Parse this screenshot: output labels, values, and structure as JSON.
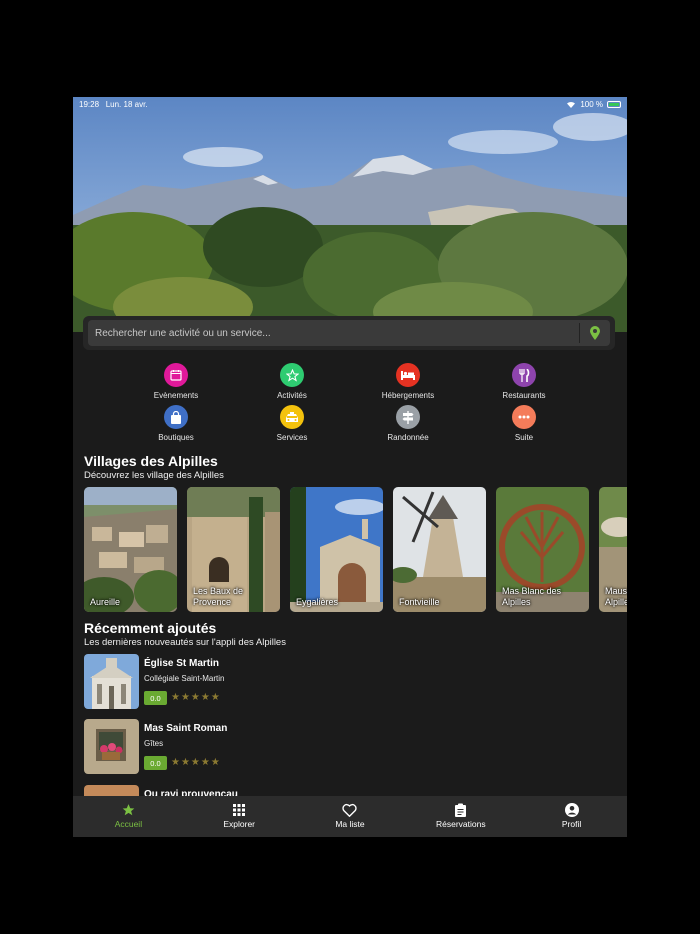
{
  "status_bar": {
    "time": "19:28",
    "date": "Lun. 18 avr.",
    "battery": "100 %"
  },
  "search": {
    "placeholder": "Rechercher une activité ou un service..."
  },
  "categories": [
    {
      "label": "Evènements",
      "icon": "calendar-icon",
      "color": "#e0199a"
    },
    {
      "label": "Activités",
      "icon": "star-icon",
      "color": "#2ecc71"
    },
    {
      "label": "Hébergements",
      "icon": "bed-icon",
      "color": "#e53222"
    },
    {
      "label": "Restaurants",
      "icon": "utensils-icon",
      "color": "#8e44ad"
    },
    {
      "label": "Boutiques",
      "icon": "bag-icon",
      "color": "#3f6fc6"
    },
    {
      "label": "Services",
      "icon": "taxi-icon",
      "color": "#f4c20d"
    },
    {
      "label": "Randonnée",
      "icon": "signpost-icon",
      "color": "#9aa0a6"
    },
    {
      "label": "Suite",
      "icon": "more-icon",
      "color": "#f47c5a"
    }
  ],
  "villages": {
    "title": "Villages des Alpilles",
    "subtitle": "Découvrez les village des Alpilles",
    "items": [
      {
        "label": "Aureille"
      },
      {
        "label": "Les Baux de Provence"
      },
      {
        "label": "Eygalières"
      },
      {
        "label": "Fontvieille"
      },
      {
        "label": "Mas Blanc des Alpilles"
      },
      {
        "label": "Maussane les Alpilles"
      }
    ]
  },
  "recent": {
    "title": "Récemment ajoutés",
    "subtitle": "Les dernières nouveautés sur l'appli des Alpilles",
    "items": [
      {
        "title": "Église St Martin",
        "subtitle": "Collégiale Saint-Martin",
        "score": "0.0",
        "stars": "★★★★★"
      },
      {
        "title": "Mas Saint Roman",
        "subtitle": "Gîtes",
        "score": "0.0",
        "stars": "★★★★★"
      },
      {
        "title": "Ou ravi prouvençau",
        "subtitle": "",
        "score": "",
        "stars": ""
      }
    ]
  },
  "tabbar": [
    {
      "label": "Accueil",
      "icon": "star-icon",
      "active": true
    },
    {
      "label": "Explorer",
      "icon": "grid-icon"
    },
    {
      "label": "Ma liste",
      "icon": "heart-icon"
    },
    {
      "label": "Réservations",
      "icon": "clipboard-icon"
    },
    {
      "label": "Profil",
      "icon": "user-icon"
    }
  ],
  "colors": {
    "accent": "#7bc043",
    "background": "#1b1b1b",
    "tabbar": "#2c2c2c"
  }
}
